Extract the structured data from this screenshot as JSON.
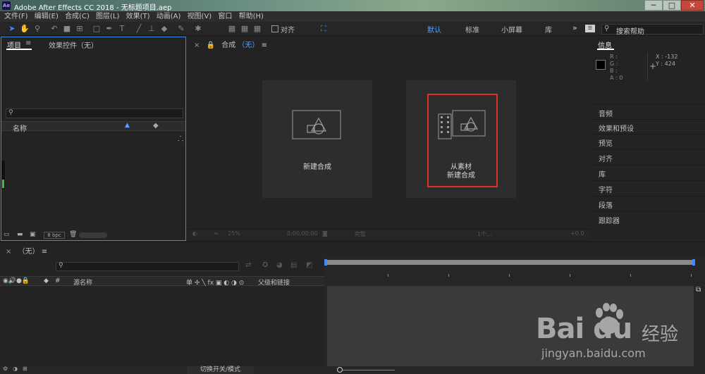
{
  "window": {
    "app_icon": "Ae",
    "title": "Adobe After Effects CC 2018 - 无标题项目.aep",
    "controls": {
      "minimize": "─",
      "maximize": "□",
      "close": "✕"
    }
  },
  "menu": [
    "文件(F)",
    "编辑(E)",
    "合成(C)",
    "图层(L)",
    "效果(T)",
    "动画(A)",
    "视图(V)",
    "窗口",
    "帮助(H)"
  ],
  "toolbar": {
    "snap_label": "对齐",
    "workspaces": [
      {
        "label": "默认",
        "active": true
      },
      {
        "label": "标准",
        "active": false
      },
      {
        "label": "小屏幕",
        "active": false
      },
      {
        "label": "库",
        "active": false
      }
    ],
    "more": "»",
    "search_help_placeholder": "搜索帮助"
  },
  "project_panel": {
    "tab_project": "项目",
    "tab_menu": "≡",
    "tab_effects": "效果控件（无）",
    "search_icon": "⚲",
    "col_name": "名称",
    "bpc": "8 bpc"
  },
  "composition_panel": {
    "tab_close": "×",
    "tab_lock": "🔒",
    "tab_label": "合成",
    "tab_value": "（无）",
    "tab_menu": "≡",
    "new_comp_label": "新建合成",
    "from_footage_line1": "从素材",
    "from_footage_line2": "新建合成",
    "footer_zoom": "25%",
    "footer_time": "0;00;00;00",
    "footer_quality": "完整",
    "footer_view": "1个...",
    "footer_offset": "+0.0"
  },
  "info_panel": {
    "title": "信息",
    "r": "R :",
    "g": "G :",
    "b": "B :",
    "a": "A : 0",
    "x": "X : -132",
    "y": "Y : 424",
    "swatch_color": "#000000"
  },
  "right_panels": [
    "音频",
    "效果和预设",
    "预览",
    "对齐",
    "库",
    "字符",
    "段落",
    "跟踪器"
  ],
  "timeline": {
    "tab_close": "×",
    "tab_label": "（无）",
    "tab_menu": "≡",
    "search_icon": "⚲",
    "col_source_name": "源名称",
    "col_hash": "#",
    "col_parent": "父级和链接",
    "col_switches": "单 ✢ ╲ fx ▣ ◐ ◑ ⊙",
    "toggle_mode": "切换开关/模式"
  },
  "watermark": {
    "brand": "Bai du",
    "cn": "经验",
    "url": "jingyan.baidu.com"
  },
  "colors": {
    "accent": "#3d8bff",
    "highlight_box": "#e0302a",
    "panel_bg": "#232323"
  }
}
